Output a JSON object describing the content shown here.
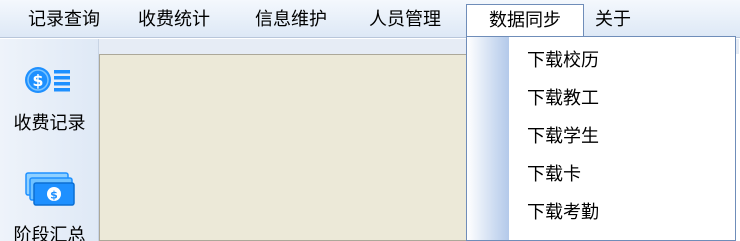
{
  "menubar": {
    "items": [
      {
        "label": "记录查询"
      },
      {
        "label": "收费统计"
      },
      {
        "label": "信息维护"
      },
      {
        "label": "人员管理"
      },
      {
        "label": "数据同步"
      },
      {
        "label": "关于"
      }
    ]
  },
  "sidebar": {
    "buttons": [
      {
        "label": "收费记录",
        "icon": "coin-list-icon"
      },
      {
        "label": "阶段汇总",
        "icon": "banknotes-icon"
      }
    ]
  },
  "dropdown": {
    "items": [
      {
        "label": "下载校历"
      },
      {
        "label": "下载教工"
      },
      {
        "label": "下载学生"
      },
      {
        "label": "下载卡"
      },
      {
        "label": "下载考勤"
      }
    ]
  },
  "colors": {
    "accent": "#1e90ff",
    "menu_border": "#6f8db9",
    "workspace_bg": "#ece9d8"
  }
}
